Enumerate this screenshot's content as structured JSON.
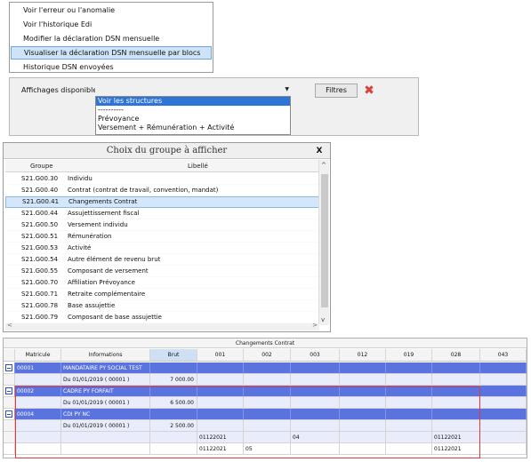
{
  "menu": {
    "items": [
      "Voir l'erreur ou l'anomalie",
      "Voir l'historique Edi",
      "Modifier la déclaration DSN mensuelle",
      "Visualiser la déclaration DSN mensuelle par blocs",
      "Historique DSN envoyées"
    ],
    "selected_index": 3
  },
  "affichages": {
    "label": "Affichages disponibles :",
    "options": [
      "Voir les structures",
      "----------",
      "Prévoyance",
      "Versement + Rémunération + Activité"
    ],
    "selected": "Voir les structures",
    "filtres_label": "Filtres",
    "clear_icon": "red-x-icon",
    "dropdown_icon": "chevron-down-icon"
  },
  "dialog": {
    "title": "Choix du groupe à afficher",
    "close_label": "X",
    "columns": [
      "Groupe",
      "Libellé"
    ],
    "rows": [
      {
        "groupe": "S21.G00.30",
        "libelle": "Individu"
      },
      {
        "groupe": "S21.G00.40",
        "libelle": "Contrat (contrat de travail, convention, mandat)"
      },
      {
        "groupe": "S21.G00.41",
        "libelle": "Changements Contrat",
        "selected": true
      },
      {
        "groupe": "S21.G00.44",
        "libelle": "Assujettissement fiscal"
      },
      {
        "groupe": "S21.G00.50",
        "libelle": "Versement individu"
      },
      {
        "groupe": "S21.G00.51",
        "libelle": "Rémunération"
      },
      {
        "groupe": "S21.G00.53",
        "libelle": "Activité"
      },
      {
        "groupe": "S21.G00.54",
        "libelle": "Autre élément de revenu brut"
      },
      {
        "groupe": "S21.G00.55",
        "libelle": "Composant de versement"
      },
      {
        "groupe": "S21.G00.70",
        "libelle": "Affiliation Prévoyance"
      },
      {
        "groupe": "S21.G00.71",
        "libelle": "Retraite complémentaire"
      },
      {
        "groupe": "S21.G00.78",
        "libelle": "Base assujettie"
      },
      {
        "groupe": "S21.G00.79",
        "libelle": "Composant de base assujettie"
      }
    ]
  },
  "grid": {
    "title": "Changements Contrat",
    "columns": [
      "Matricule",
      "Informations",
      "Brut",
      "001",
      "002",
      "003",
      "012",
      "019",
      "028",
      "043"
    ],
    "rows": [
      {
        "kind": "blue",
        "cells": [
          "00001",
          "MANDATAIRE PY  SOCIAL TEST",
          "",
          "",
          "",
          "",
          "",
          "",
          "",
          ""
        ]
      },
      {
        "kind": "light",
        "cells": [
          "",
          "Du 01/01/2019 ( 00001 )",
          "7 000.00",
          "",
          "",
          "",
          "",
          "",
          "",
          ""
        ]
      },
      {
        "kind": "blue",
        "cells": [
          "00002",
          "CADRE PY  FORFAIT",
          "",
          "",
          "",
          "",
          "",
          "",
          "",
          ""
        ]
      },
      {
        "kind": "light",
        "cells": [
          "",
          "Du 01/01/2019 ( 00001 )",
          "6 500.00",
          "",
          "",
          "",
          "",
          "",
          "",
          ""
        ]
      },
      {
        "kind": "blue",
        "cells": [
          "00004",
          "CDI PY  NC",
          "",
          "",
          "",
          "",
          "",
          "",
          "",
          ""
        ]
      },
      {
        "kind": "light",
        "cells": [
          "",
          "Du 01/01/2019 ( 00001 )",
          "2 500.00",
          "",
          "",
          "",
          "",
          "",
          "",
          ""
        ]
      },
      {
        "kind": "light",
        "cells": [
          "",
          "",
          "",
          "01122021",
          "",
          "04",
          "",
          "",
          "01122021",
          ""
        ]
      },
      {
        "kind": "white",
        "cells": [
          "",
          "",
          "",
          "01122021",
          "05",
          "",
          "",
          "",
          "01122021",
          ""
        ]
      }
    ]
  }
}
